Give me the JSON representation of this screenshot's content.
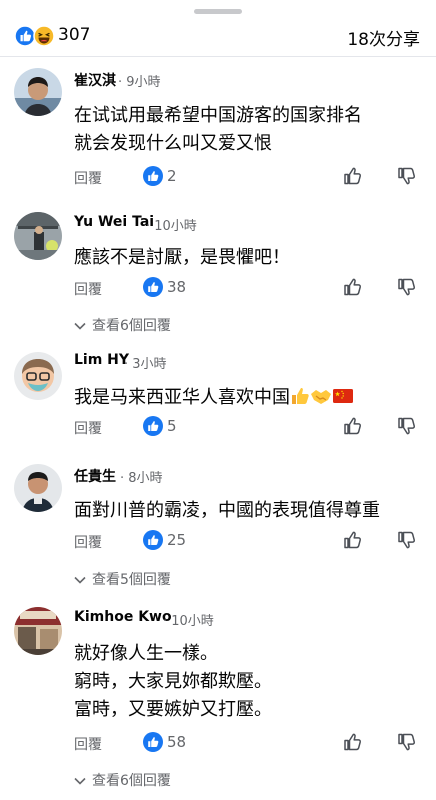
{
  "header": {
    "reaction_count": "307",
    "share_count": "18次分享"
  },
  "colors": {
    "like_blue": "#1877f2",
    "haha_yellow": "#f7b928",
    "secondary_text": "#65676b"
  },
  "comments": [
    {
      "author": "崔汉淇",
      "time": "· 9小時",
      "lines": [
        "在试试用最希望中国游客的国家排名",
        "就会发现什么叫又爱又恨"
      ],
      "reply_label": "回覆",
      "likes": "2",
      "more_replies": ""
    },
    {
      "author": "Yu Wei Tai",
      "time": "· 10小時",
      "lines": [
        "應該不是討厭，是畏懼吧！"
      ],
      "reply_label": "回覆",
      "likes": "38",
      "more_replies": "查看6個回覆"
    },
    {
      "author": "Lim HY",
      "time": "· 3小時",
      "lines": [
        "我是马来西亚华人喜欢中国"
      ],
      "emojis": [
        "thumbs-up",
        "handshake",
        "china-flag"
      ],
      "reply_label": "回覆",
      "likes": "5",
      "more_replies": ""
    },
    {
      "author": "任貴生",
      "time": "· 8小時",
      "lines": [
        "面對川普的霸凌，中國的表現值得尊重"
      ],
      "reply_label": "回覆",
      "likes": "25",
      "more_replies": "查看5個回覆"
    },
    {
      "author": "Kimhoe  Kwo",
      "time": "· 10小時",
      "lines": [
        "就好像人生一樣。",
        "窮時，大家見妳都欺壓。",
        "富時，又要嫉妒又打壓。"
      ],
      "reply_label": "回覆",
      "likes": "58",
      "more_replies": "查看6個回覆"
    }
  ]
}
